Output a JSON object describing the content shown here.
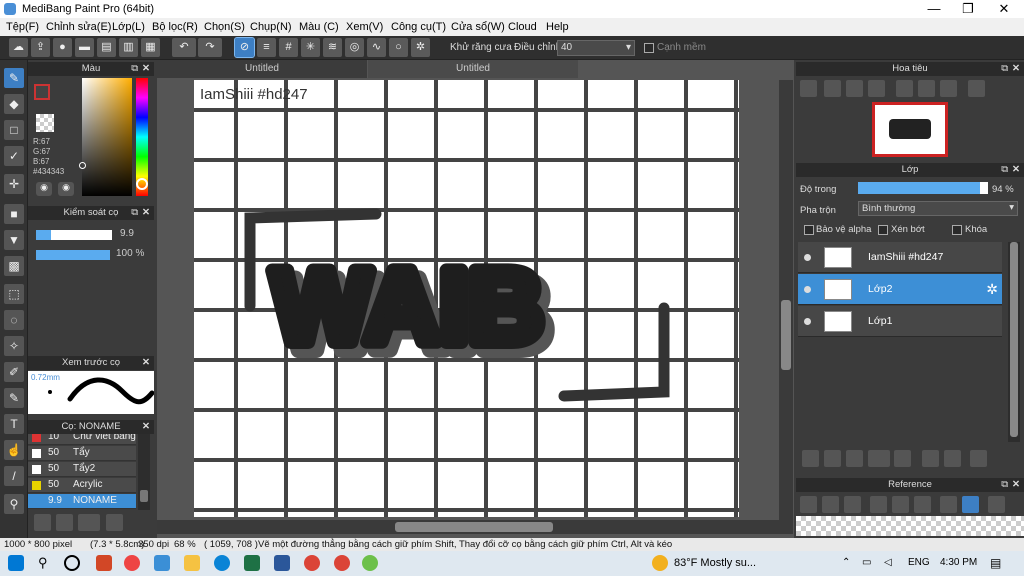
{
  "window": {
    "title": "MediBang Paint Pro (64bit)",
    "minimize": "—",
    "maximize": "❐",
    "close": "✕"
  },
  "menu": [
    "Tệp(F)",
    "Chỉnh sửa(E)",
    "Lớp(L)",
    "Bộ lọc(R)",
    "Chọn(S)",
    "Chụp(N)",
    "Màu (C)",
    "Xem(V)",
    "Công cụ(T)",
    "Cửa sổ(W)",
    "Cloud",
    "Help"
  ],
  "toolbar": {
    "antialias_label": "Khử răng cưa",
    "adjust_label": "Điều chỉnh",
    "adjust_value": "40",
    "edge_label": "Cạnh mềm"
  },
  "tabs": [
    "Untitled",
    "Untitled"
  ],
  "color_panel": {
    "title": "Màu",
    "r": "R:67",
    "g": "G:67",
    "b": "B:67",
    "hex": "#434343",
    "fg_color": "#434343",
    "bg_color": "#ffffff"
  },
  "brush_control": {
    "title": "Kiểm soát cọ",
    "size_value": "9.9",
    "opacity_value": "100 %"
  },
  "brush_preview": {
    "title": "Xem trước cọ",
    "size": "0.72mm"
  },
  "brush_list": {
    "title": "Cọ: NONAME",
    "items": [
      {
        "size": "10",
        "name": "Chữ viết bằng",
        "color": "#d33"
      },
      {
        "size": "50",
        "name": "Tẩy",
        "color": "#ffffff"
      },
      {
        "size": "50",
        "name": "Tẩy2",
        "color": "#ffffff"
      },
      {
        "size": "50",
        "name": "Acrylic",
        "color": "#e8d400"
      },
      {
        "size": "9.9",
        "name": "NONAME",
        "color": "#3d8fd6"
      }
    ]
  },
  "canvas": {
    "watermark_text": "IamShiii #hd247",
    "art_text": "WAIB"
  },
  "navigator": {
    "title": "Hoa tiêu"
  },
  "layers": {
    "title": "Lớp",
    "opacity_label": "Độ trong",
    "opacity_value": "94 %",
    "opacity_fraction": 0.94,
    "blend_label": "Pha trộn",
    "blend_value": "Bình thường",
    "protect_alpha": "Bảo vệ alpha",
    "clipping": "Xén bớt",
    "lock": "Khóa",
    "items": [
      {
        "name": "IamShiii #hd247",
        "selected": false
      },
      {
        "name": "Lớp2",
        "selected": true
      },
      {
        "name": "Lớp1",
        "selected": false
      }
    ]
  },
  "reference": {
    "title": "Reference"
  },
  "status": {
    "size": "1000 * 800 pixel",
    "cm": "(7.3 * 5.8cm)",
    "dpi": "350 dpi",
    "zoom": "68 %",
    "coords": "( 1059, 708 )",
    "hint": "Vẽ một đường thẳng bằng cách giữ phím Shift, Thay đổi cỡ cọ bằng cách giữ phím Ctrl, Alt và kéo"
  },
  "taskbar": {
    "weather": "83°F Mostly su...",
    "lang": "ENG",
    "time": "4:30 PM"
  }
}
